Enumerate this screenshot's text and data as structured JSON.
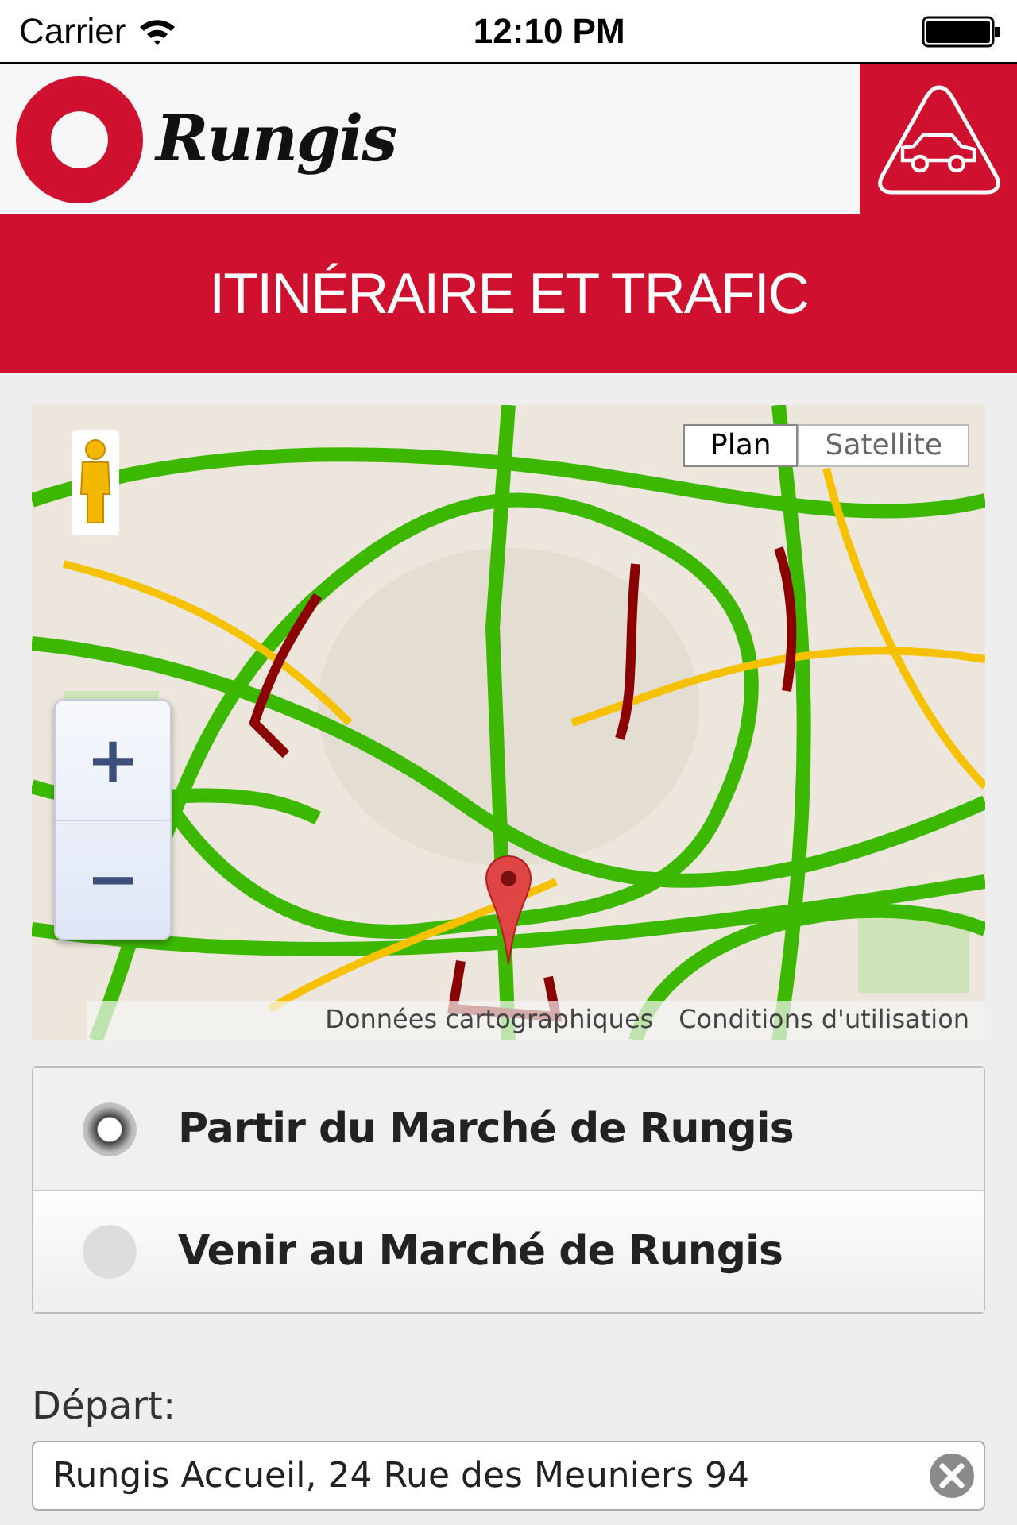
{
  "status_bar": {
    "carrier": "Carrier",
    "time": "12:10 PM"
  },
  "header": {
    "logo_text": "Rungis"
  },
  "title": "ITINÉRAIRE ET TRAFIC",
  "map": {
    "kind": "picture",
    "map_types": [
      {
        "label": "Plan",
        "selected": true
      },
      {
        "label": "Satellite",
        "selected": false
      }
    ],
    "zoom_in": "+",
    "zoom_out": "−",
    "links": [
      "Données cartographiques",
      "Conditions d'utilisation"
    ]
  },
  "options": [
    {
      "label": "Partir du Marché de Rungis",
      "selected": true
    },
    {
      "label": "Venir au Marché de Rungis",
      "selected": false
    }
  ],
  "departure": {
    "label": "Départ:",
    "value": "Rungis Accueil, 24 Rue des Meuniers 94"
  }
}
